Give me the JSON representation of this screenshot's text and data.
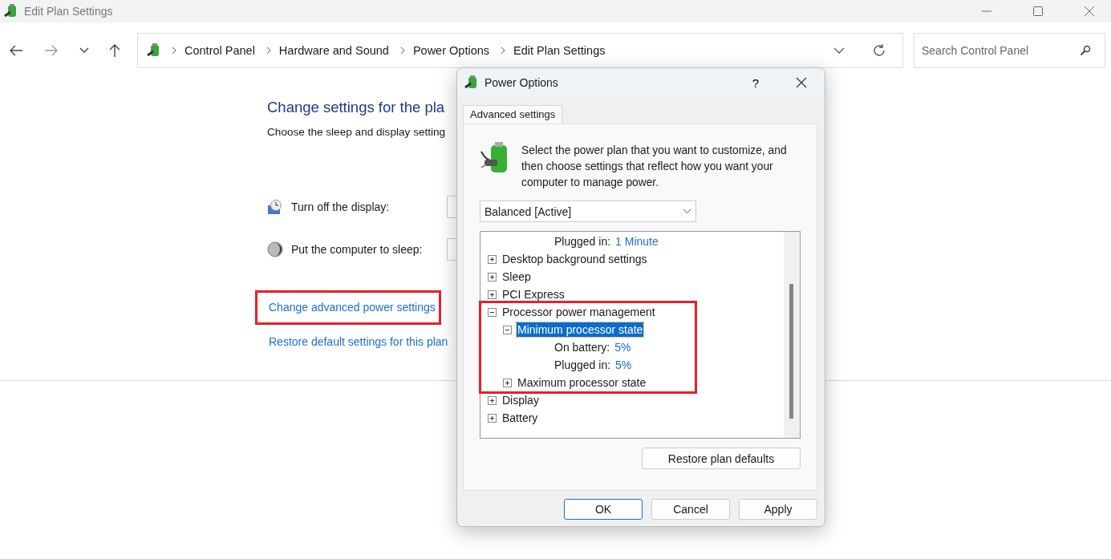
{
  "window": {
    "title": "Edit Plan Settings"
  },
  "breadcrumb": [
    "Control Panel",
    "Hardware and Sound",
    "Power Options",
    "Edit Plan Settings"
  ],
  "search": {
    "placeholder": "Search Control Panel"
  },
  "page": {
    "heading": "Change settings for the pla",
    "subtitle": "Choose the sleep and display setting",
    "settings": [
      {
        "kind": "display",
        "label": "Turn off the display:"
      },
      {
        "kind": "sleep",
        "label": "Put the computer to sleep:"
      }
    ],
    "links": [
      {
        "label": "Change advanced power settings",
        "highlighted": true
      },
      {
        "label": "Restore default settings for this plan",
        "highlighted": false
      }
    ]
  },
  "dialog": {
    "title": "Power Options",
    "help": "?",
    "tabs": [
      {
        "label": "Advanced settings",
        "selected": true
      }
    ],
    "intro": "Select the power plan that you want to customize, and then choose settings that reflect how you want your computer to manage power.",
    "plan": "Balanced [Active]",
    "tree": [
      {
        "children": [
          {
            "children": [
              {
                "kind": "setting",
                "label": "Plugged in:",
                "value": "1 Minute"
              }
            ]
          }
        ]
      },
      {
        "kind": "group",
        "label": "Desktop background settings",
        "expanded": false,
        "selected": false,
        "highlighted": false
      },
      {
        "kind": "group",
        "label": "Sleep",
        "expanded": false,
        "selected": false,
        "highlighted": false
      },
      {
        "kind": "group",
        "label": "PCI Express",
        "expanded": false,
        "selected": false,
        "highlighted": false
      },
      {
        "kind": "group",
        "label": "Processor power management",
        "expanded": true,
        "selected": false,
        "highlighted": true,
        "children": [
          {
            "kind": "group",
            "label": "Minimum processor state",
            "expanded": true,
            "selected": true,
            "children": [
              {
                "kind": "setting",
                "label": "On battery:",
                "value": "5%"
              },
              {
                "kind": "setting",
                "label": "Plugged in:",
                "value": "5%"
              }
            ]
          },
          {
            "kind": "group",
            "label": "Maximum processor state",
            "expanded": false,
            "selected": false
          }
        ]
      },
      {
        "kind": "group",
        "label": "Display",
        "expanded": false,
        "selected": false,
        "highlighted": false
      },
      {
        "kind": "group",
        "label": "Battery",
        "expanded": false,
        "selected": false,
        "highlighted": false
      }
    ],
    "restore": "Restore plan defaults",
    "buttons": [
      {
        "label": "OK",
        "default": true
      },
      {
        "label": "Cancel",
        "default": false
      },
      {
        "label": "Apply",
        "default": false
      }
    ]
  }
}
